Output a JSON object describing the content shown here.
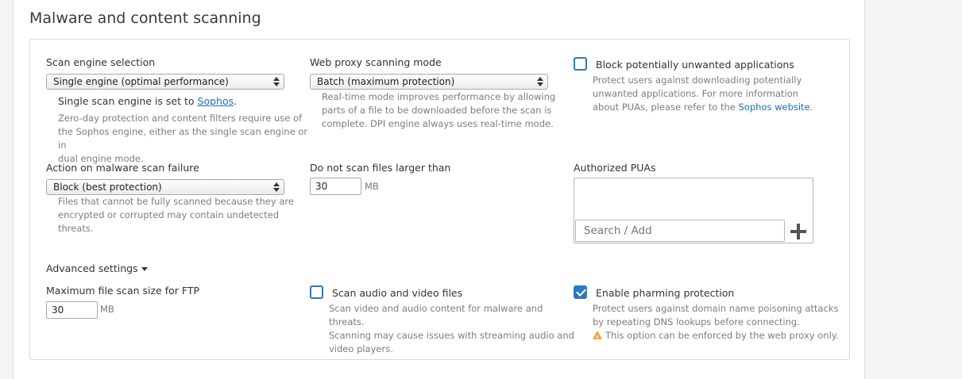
{
  "section": {
    "title": "Malware and content scanning"
  },
  "scan_engine": {
    "label": "Scan engine selection",
    "selected": "Single engine (optimal performance)",
    "engine_prefix": "Single scan engine is set to ",
    "engine_name": "Sophos",
    "engine_suffix": ".",
    "help_lines": [
      "Zero-day protection and content filters require use of",
      "the Sophos engine, either as the single scan engine or in",
      "dual engine mode."
    ]
  },
  "proxy_mode": {
    "label": "Web proxy scanning mode",
    "selected": "Batch (maximum protection)",
    "help_lines": [
      "Real-time mode improves performance by allowing",
      "parts of a file to be downloaded before the scan is",
      "complete. DPI engine always uses real-time mode."
    ]
  },
  "pua": {
    "label": "Block potentially unwanted applications",
    "checked": false,
    "help_lines": [
      "Protect users against downloading potentially",
      "unwanted applications. For more information"
    ],
    "help_last_prefix": "about PUAs, please refer to the ",
    "help_link": "Sophos website",
    "help_last_suffix": "."
  },
  "failure_action": {
    "label": "Action on malware scan failure",
    "selected": "Block (best protection)",
    "help_lines": [
      "Files that cannot be fully scanned because they are",
      "encrypted or corrupted may contain undetected threats."
    ]
  },
  "max_size": {
    "label": "Do not scan files larger than",
    "value": "30",
    "unit": "MB"
  },
  "authorized_puas": {
    "label": "Authorized PUAs",
    "search_placeholder": "Search / Add"
  },
  "advanced": {
    "label": "Advanced settings"
  },
  "ftp_size": {
    "label": "Maximum file scan size for FTP",
    "value": "30",
    "unit": "MB"
  },
  "audio_video": {
    "label": "Scan audio and video files",
    "checked": false,
    "help_lines": [
      "Scan video and audio content for malware and threats.",
      "Scanning may cause issues with streaming audio and",
      "video players."
    ]
  },
  "pharming": {
    "label": "Enable pharming protection",
    "checked": true,
    "help_lines": [
      "Protect users against domain name poisoning attacks",
      "by repeating DNS lookups before connecting."
    ],
    "warning": "This option can be enforced by the web proxy only."
  },
  "colors": {
    "accent": "#2a79c4",
    "link": "#1f6fb2",
    "warning": "#f0a23a"
  }
}
